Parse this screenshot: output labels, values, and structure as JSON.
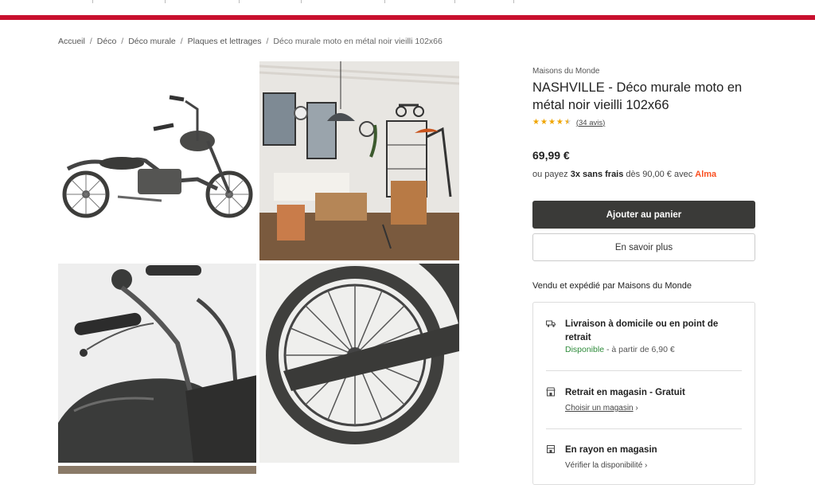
{
  "breadcrumb": {
    "items": [
      "Accueil",
      "Déco",
      "Déco murale",
      "Plaques et lettrages"
    ],
    "current": "Déco murale moto en métal noir vieilli 102x66",
    "separator": "/"
  },
  "gallery": {
    "images": [
      "motorcycle-product-photo",
      "living-room-scene-photo",
      "handlebar-detail-photo",
      "wheel-detail-photo"
    ]
  },
  "product": {
    "brand": "Maisons du Monde",
    "title": "NASHVILLE - Déco murale moto en métal noir vieilli 102x66",
    "rating": 4.5,
    "rating_max": 5,
    "reviews": "(34 avis)",
    "price": "69,99 €"
  },
  "payment": {
    "prefix": "ou payez ",
    "bold": "3x sans frais",
    "suffix": " dès 90,00 € avec ",
    "provider": "Alma"
  },
  "actions": {
    "add_to_cart": "Ajouter au panier",
    "learn_more": "En savoir plus"
  },
  "seller": "Vendu et expédié par Maisons du Monde",
  "delivery": {
    "home": {
      "title": "Livraison à domicile ou en point de retrait",
      "status": "Disponible",
      "detail": " - à partir de 6,90 €",
      "icon": "truck-icon"
    },
    "store_pickup": {
      "title": "Retrait en magasin - Gratuit",
      "link": "Choisir un magasin",
      "icon": "store-icon"
    },
    "in_store": {
      "title": "En rayon en magasin",
      "link": "Vérifier la disponibilité",
      "icon": "shop-icon"
    }
  },
  "colors": {
    "brand_red": "#c8102e",
    "button_dark": "#3a3a38",
    "star": "#f0a500",
    "alma": "#fa5022",
    "available_green": "#2e8b3a"
  }
}
